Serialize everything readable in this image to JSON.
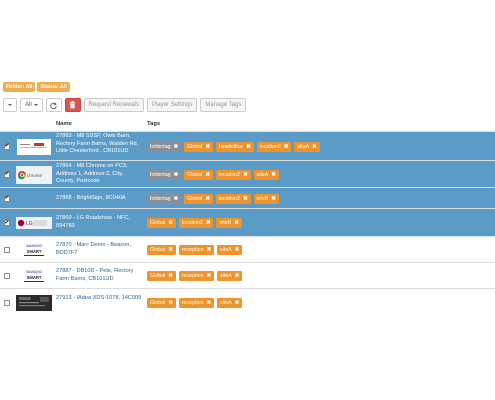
{
  "filters": {
    "folder": "Folder: All",
    "status": "Status: All"
  },
  "toolbar": {
    "all_label": "All",
    "request_renewals": "Request Renewals",
    "player_settings": "Player Settings",
    "manage_tags": "Manage Tags"
  },
  "columns": {
    "name": "Name",
    "tags": "Tags"
  },
  "rows": [
    {
      "id": "r1",
      "selected": true,
      "thumb": "laptop",
      "name": "27863 - M8 SSSP, Owls Barn, Rectory Farm Barns, Walden Rd, Little Chesterford , CB101UD",
      "tags": [
        [
          "foldertag",
          "g"
        ],
        [
          "Global",
          "o"
        ],
        [
          "headoffice",
          "o"
        ],
        [
          "location2",
          "o"
        ],
        [
          "siteA",
          "o"
        ]
      ]
    },
    {
      "id": "r2",
      "selected": true,
      "thumb": "chrome",
      "name": "27864 - M8 Chrome on PC3, Address 1, Address 2, City, County, Postcode",
      "tags": [
        [
          "foldertag",
          "g"
        ],
        [
          "Global",
          "o"
        ],
        [
          "location2",
          "o"
        ],
        [
          "siteA",
          "o"
        ]
      ]
    },
    {
      "id": "r3",
      "selected": true,
      "thumb": "blank",
      "name": "27868 - BrightSign, 9C040A",
      "tags": [
        [
          "foldertag",
          "g"
        ],
        [
          "Global",
          "o"
        ],
        [
          "location2",
          "o"
        ],
        [
          "siteB",
          "o"
        ]
      ]
    },
    {
      "id": "r4",
      "selected": true,
      "thumb": "lg",
      "name": "27869 - LG Roadshow - NFC, 894783",
      "tags": [
        [
          "Global",
          "o"
        ],
        [
          "location2",
          "o"
        ],
        [
          "siteB",
          "o"
        ]
      ]
    },
    {
      "id": "r5",
      "selected": false,
      "thumb": "samsung",
      "name": "27870 - Marc Demo - Beacon, BDD7F7",
      "tags": [
        [
          "Global",
          "o"
        ],
        [
          "reception",
          "o"
        ],
        [
          "siteA",
          "o"
        ]
      ]
    },
    {
      "id": "r6",
      "selected": false,
      "thumb": "samsung",
      "name": "27887 - DB10D - Pete, Rectory Farm Barns, CB101UD",
      "tags": [
        [
          "Global",
          "o"
        ],
        [
          "reception",
          "o"
        ],
        [
          "siteA",
          "o"
        ]
      ]
    },
    {
      "id": "r7",
      "selected": false,
      "thumb": "dark",
      "name": "27913 - IAdea XDS-1078, 14C009",
      "tags": [
        [
          "Global",
          "o"
        ],
        [
          "reception",
          "o"
        ],
        [
          "siteA",
          "o"
        ]
      ]
    }
  ],
  "thumb_text": {
    "lg": "LG",
    "samsung_top": "SAMSUNG",
    "samsung_bottom": "SMART",
    "chrome": "chrome"
  }
}
